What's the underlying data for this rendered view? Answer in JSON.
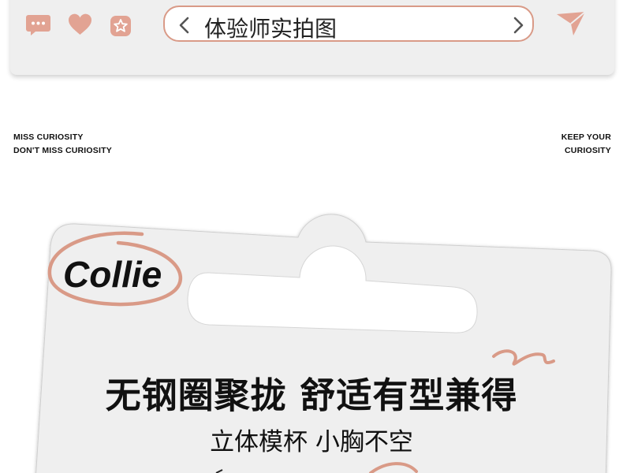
{
  "toolbar": {
    "search_text": "体验师实拍图",
    "icons": [
      "message-icon",
      "heart-icon",
      "star-badge-icon",
      "back-arrow-icon",
      "forward-arrow-icon",
      "send-icon"
    ]
  },
  "taglines": {
    "left_line1": "MISS CURIOSITY",
    "left_line2": "DON'T MISS CURIOSITY",
    "right_line1": "KEEP YOUR",
    "right_line2": "CURIOSITY"
  },
  "card": {
    "brand": "Collie",
    "headline": "无钢圈聚拢 舒适有型兼得",
    "subheadline": "立体模杯 小胸不空"
  },
  "colors": {
    "accent": "#d99a87",
    "icon_fill": "#e2a393",
    "toolbar_bg": "#efefef",
    "card_bg": "#efefef"
  }
}
